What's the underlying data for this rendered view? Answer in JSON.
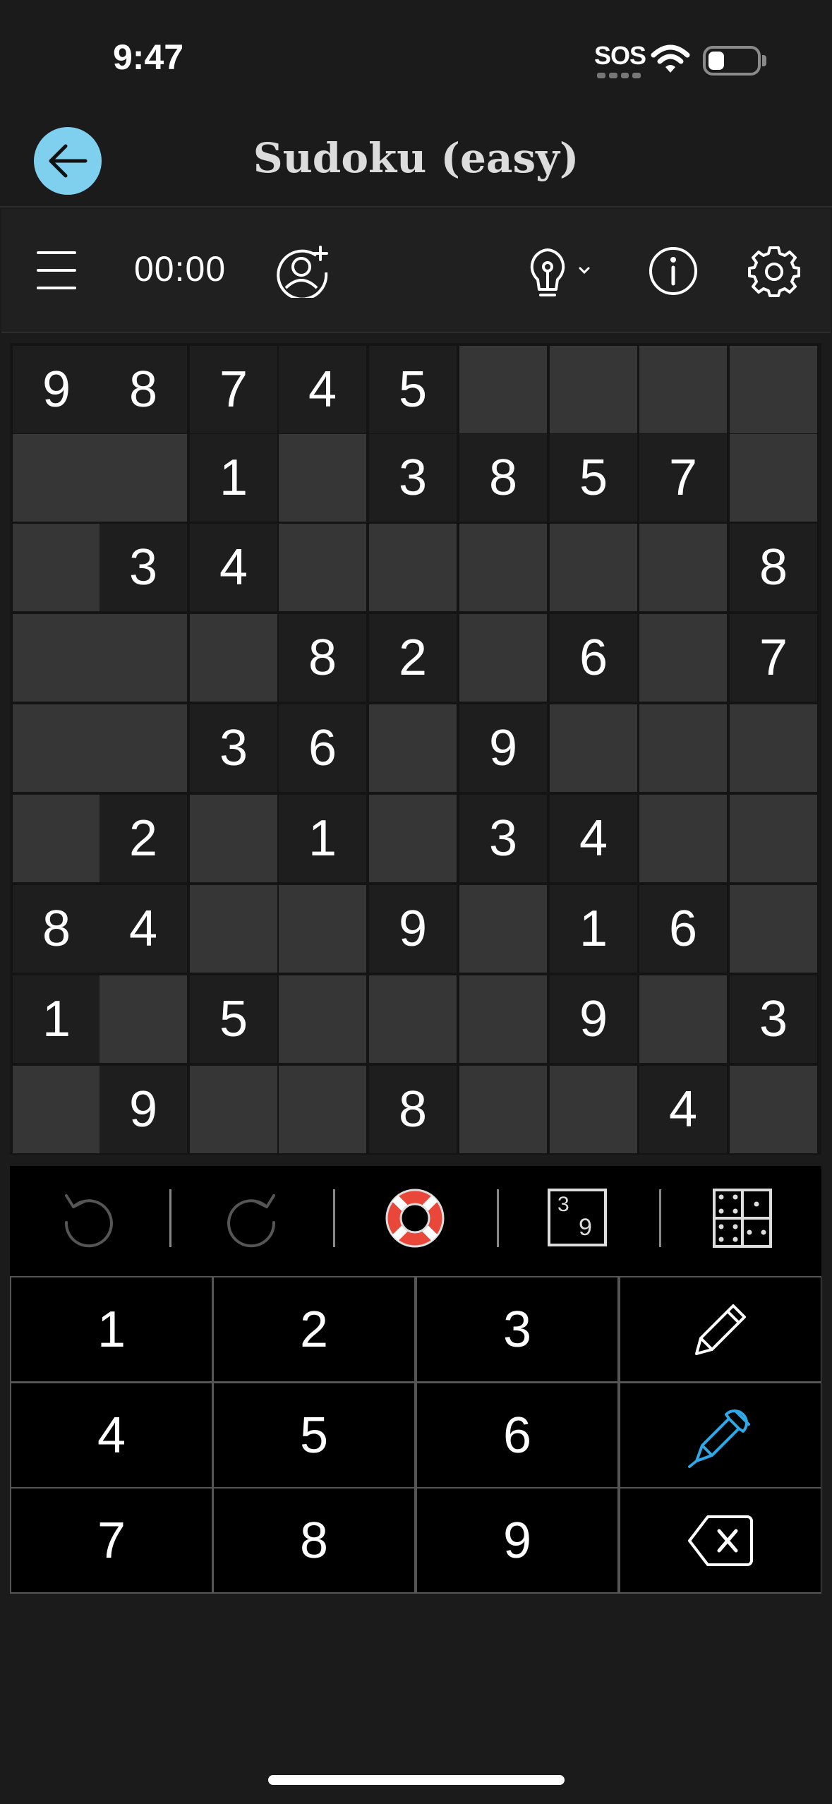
{
  "status_bar": {
    "time": "9:47",
    "sos": "SOS"
  },
  "header": {
    "title": "Sudoku (easy)"
  },
  "toolbar": {
    "timer": "00:00"
  },
  "colors": {
    "accent": "#7fd0ef",
    "pen_active": "#2fa8e8",
    "lifebuoy": "#e8473a"
  },
  "grid": {
    "rows": [
      [
        9,
        8,
        7,
        4,
        5,
        0,
        0,
        0,
        0
      ],
      [
        0,
        0,
        1,
        0,
        3,
        8,
        5,
        7,
        0
      ],
      [
        0,
        3,
        4,
        0,
        0,
        0,
        0,
        0,
        8
      ],
      [
        0,
        0,
        0,
        8,
        2,
        0,
        6,
        0,
        7
      ],
      [
        0,
        0,
        3,
        6,
        0,
        9,
        0,
        0,
        0
      ],
      [
        0,
        2,
        0,
        1,
        0,
        3,
        4,
        0,
        0
      ],
      [
        8,
        4,
        0,
        0,
        9,
        0,
        1,
        6,
        0
      ],
      [
        1,
        0,
        5,
        0,
        0,
        0,
        9,
        0,
        3
      ],
      [
        0,
        9,
        0,
        0,
        8,
        0,
        0,
        4,
        0
      ]
    ]
  },
  "candidate_icon": {
    "top": "3",
    "bottom": "9"
  },
  "keypad": {
    "digits": [
      "1",
      "2",
      "3",
      "4",
      "5",
      "6",
      "7",
      "8",
      "9"
    ]
  },
  "icons": {
    "back": "arrow-left-icon",
    "menu": "hamburger-menu-icon",
    "add_player": "add-person-icon",
    "hint": "lightbulb-icon",
    "info": "info-icon",
    "settings": "gear-icon",
    "undo": "undo-icon",
    "redo": "redo-icon",
    "help": "lifebuoy-icon",
    "candidates": "candidates-icon",
    "notes_grid": "notes-grid-icon",
    "pencil": "pencil-icon",
    "pen": "pen-icon",
    "erase": "backspace-icon"
  }
}
